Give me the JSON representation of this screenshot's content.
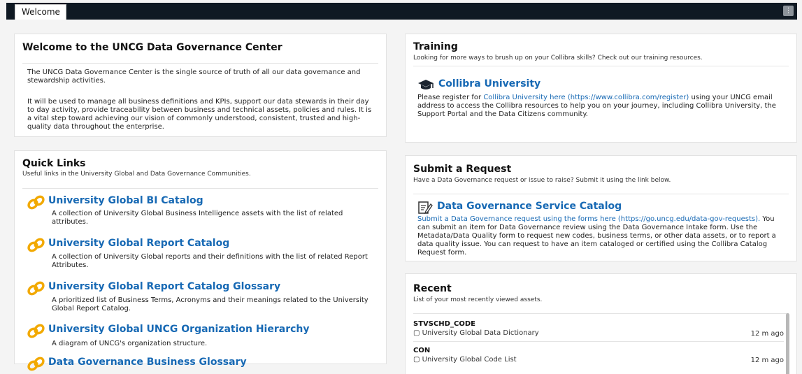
{
  "tabs": {
    "welcome": "Welcome",
    "menu": "⋮"
  },
  "welcome": {
    "title": "Welcome to the UNCG Data Governance Center",
    "p1": "The UNCG Data Governance Center is the single source of truth of all our data governance and stewardship activities.",
    "p2": "It will be used to manage all business definitions and KPIs, support our data stewards in their day to day activity, provide traceability between business and technical assets, policies and rules. It is a vital step toward achieving our vision of commonly understood, consistent, trusted and high-quality data throughout the enterprise."
  },
  "quick_links": {
    "title": "Quick Links",
    "subtitle": "Useful links in the University Global and Data Governance Communities.",
    "items": [
      {
        "title": "University Global BI Catalog",
        "desc": "A collection of University Global Business Intelligence assets with the list of related attributes."
      },
      {
        "title": "University Global Report Catalog",
        "desc": "A collection of University Global reports and their definitions with the list of related Report Attributes."
      },
      {
        "title": "University Global Report Catalog Glossary",
        "desc": "A prioritized list of Business Terms, Acronyms and their meanings related to the University Global Report Catalog."
      },
      {
        "title": "University Global UNCG Organization Hierarchy",
        "desc": "A diagram of UNCG's organization structure."
      },
      {
        "title": "Data Governance Business Glossary",
        "desc": ""
      }
    ]
  },
  "training": {
    "title": "Training",
    "subtitle": "Looking for more ways to brush up on your Collibra skills? Check out our training resources.",
    "item_title": "Collibra University",
    "text_before": "Please register for ",
    "link_text": "Collibra University here (https://www.collibra.com/register)",
    "text_after": " using your UNCG email address to access the Collibra resources to help you on your journey, including Collibra University, the Support Portal and the Data Citizens community."
  },
  "request": {
    "title": "Submit a Request",
    "subtitle": "Have a Data Governance request or issue to raise? Submit it using the link below.",
    "item_title": "Data Governance Service Catalog",
    "link_text": "Submit a Data Governance request using the forms here (https://go.uncg.edu/data-gov-requests).",
    "text_after": " You can submit an item for Data Governance review using the Data Governance Intake form. Use the Metadata/Data Quality form to request new codes, business terms, or other data assets, or to report a data quality issue. You can request to have an item cataloged or certified using the Collibra Catalog Request form."
  },
  "recent": {
    "title": "Recent",
    "subtitle": "List of your most recently viewed assets.",
    "items": [
      {
        "name": "STVSCHD_CODE",
        "domain": "University Global Data Dictionary",
        "time": "12 m ago"
      },
      {
        "name": "CON",
        "domain": "University Global Code List",
        "time": "12 m ago"
      }
    ]
  },
  "colors": {
    "topbar": "#0f1923",
    "link": "#1769b4",
    "chain_icon": "#f2a900"
  },
  "icons": {
    "quick_link": "chain-link-icon",
    "training": "graduation-cap-icon",
    "request": "edit-form-icon",
    "recent_domain": "domain-icon"
  }
}
